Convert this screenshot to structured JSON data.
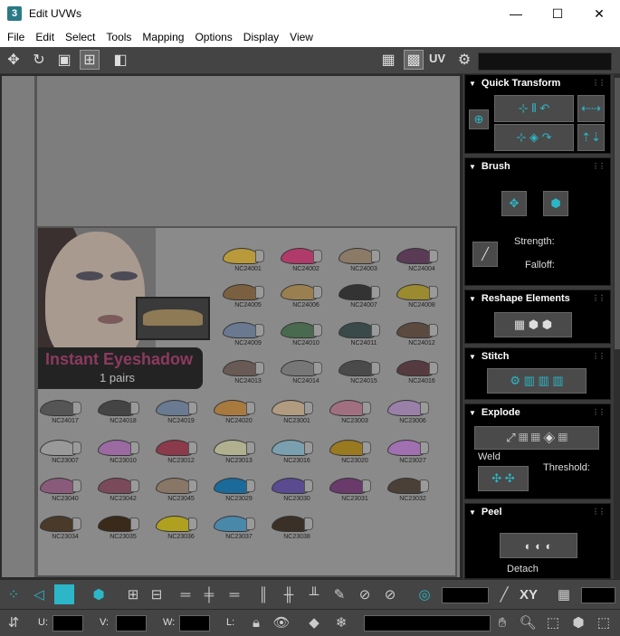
{
  "window": {
    "title": "Edit UVWs",
    "app_icon": "3",
    "controls": [
      "—",
      "☐",
      "✕"
    ]
  },
  "menu": [
    "File",
    "Edit",
    "Select",
    "Tools",
    "Mapping",
    "Options",
    "Display",
    "View"
  ],
  "toolbar": {
    "uv_label": "UV"
  },
  "viewport": {
    "banner_title": "Instant Eyeshadow",
    "banner_sub": "1 pairs",
    "swatches": [
      {
        "code": "NC24001",
        "color": "#b89a3a"
      },
      {
        "code": "NC24002",
        "color": "#b03a6a"
      },
      {
        "code": "NC24003",
        "color": "#8a7a66"
      },
      {
        "code": "NC24004",
        "color": "#5a3a55"
      },
      {
        "code": "NC24005",
        "color": "#7a6040"
      },
      {
        "code": "NC24006",
        "color": "#9a8050"
      },
      {
        "code": "NC24007",
        "color": "#333333"
      },
      {
        "code": "NC24008",
        "color": "#9a8a30"
      },
      {
        "code": "NC24009",
        "color": "#6a7890"
      },
      {
        "code": "NC24010",
        "color": "#4a6a50"
      },
      {
        "code": "NC24011",
        "color": "#3a4a4a"
      },
      {
        "code": "NC24012",
        "color": "#5a4a40"
      },
      {
        "code": "NC24013",
        "color": "#6a5a55"
      },
      {
        "code": "NC24014",
        "color": "#777777"
      },
      {
        "code": "NC24015",
        "color": "#4a4a4a"
      },
      {
        "code": "NC24016",
        "color": "#553a40"
      },
      {
        "code": "NC24017",
        "color": "#555555"
      },
      {
        "code": "NC24018",
        "color": "#444444"
      },
      {
        "code": "NC24019",
        "color": "#6a7a90"
      },
      {
        "code": "NC24020",
        "color": "#a87a40"
      },
      {
        "code": "NC23001",
        "color": "#b09a80"
      },
      {
        "code": "NC23003",
        "color": "#a07080"
      },
      {
        "code": "NC23006",
        "color": "#9a80a8"
      },
      {
        "code": "NC23007",
        "color": "#999999"
      },
      {
        "code": "NC23010",
        "color": "#9a6aa0"
      },
      {
        "code": "NC23012",
        "color": "#8a3a4a"
      },
      {
        "code": "NC23013",
        "color": "#b0b090"
      },
      {
        "code": "NC23016",
        "color": "#7aa0b0"
      },
      {
        "code": "NC23020",
        "color": "#9a7a20"
      },
      {
        "code": "NC23027",
        "color": "#a070b0"
      },
      {
        "code": "NC23040",
        "color": "#8a5a7a"
      },
      {
        "code": "NC23042",
        "color": "#7a4a5a"
      },
      {
        "code": "NC23045",
        "color": "#887766"
      },
      {
        "code": "NC23029",
        "color": "#1a6a9a"
      },
      {
        "code": "NC23030",
        "color": "#5a4a90"
      },
      {
        "code": "NC23031",
        "color": "#6a3a6a"
      },
      {
        "code": "NC23032",
        "color": "#4a4038"
      },
      {
        "code": "NC23034",
        "color": "#4a3a2a"
      },
      {
        "code": "NC23035",
        "color": "#3a2a1a"
      },
      {
        "code": "NC23036",
        "color": "#b0a020"
      },
      {
        "code": "NC23037",
        "color": "#4a88aa"
      },
      {
        "code": "NC23038",
        "color": "#3a3028"
      }
    ]
  },
  "panel": {
    "quick_transform": {
      "title": "Quick Transform"
    },
    "brush": {
      "title": "Brush",
      "strength": "Strength:",
      "falloff": "Falloff:"
    },
    "reshape": {
      "title": "Reshape Elements"
    },
    "stitch": {
      "title": "Stitch"
    },
    "explode": {
      "title": "Explode",
      "weld": "Weld",
      "threshold": "Threshold:"
    },
    "peel": {
      "title": "Peel",
      "detach": "Detach"
    }
  },
  "statusbar": {
    "u_label": "U:",
    "v_label": "V:",
    "w_label": "W:",
    "l_label": "L:",
    "xy_label": "XY"
  },
  "colors": {
    "accent": "#2bb7c7",
    "panel_bg": "#000000",
    "ui_bg": "#444444"
  }
}
